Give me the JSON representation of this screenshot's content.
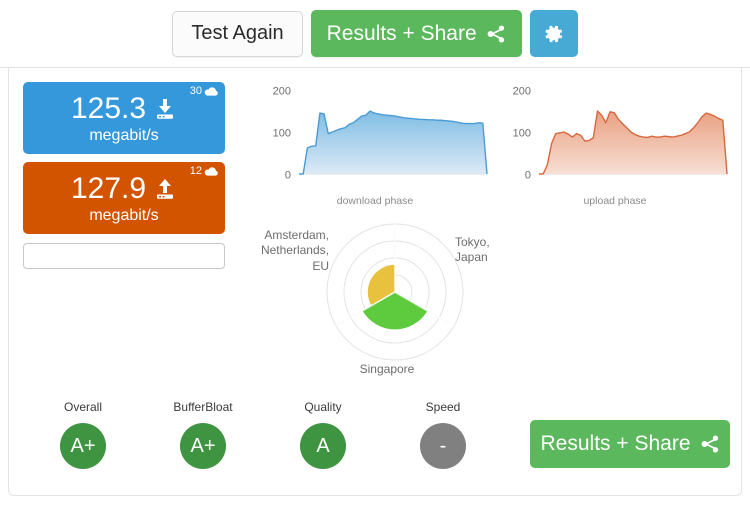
{
  "toolbar": {
    "test_again_label": "Test Again",
    "results_share_label": "Results + Share",
    "share_icon": "share-nodes-icon",
    "settings_icon": "gear-icon"
  },
  "speed": {
    "download": {
      "value": "125.3",
      "unit": "megabit/s",
      "badge_count": "30",
      "badge_icon": "cloud-icon",
      "direction_icon": "download-arrow-icon",
      "color": "#3498db"
    },
    "upload": {
      "value": "127.9",
      "unit": "megabit/s",
      "badge_count": "12",
      "badge_icon": "cloud-icon",
      "direction_icon": "upload-arrow-icon",
      "color": "#d35400"
    }
  },
  "share_input": {
    "value": "",
    "placeholder": ""
  },
  "chart_data": [
    {
      "type": "area",
      "title": "",
      "xlabel": "download phase",
      "ylabel": "",
      "ylim": [
        0,
        200
      ],
      "yticks": [
        "0",
        "100",
        "200"
      ],
      "ytick_values": [
        0,
        100,
        200
      ],
      "grid": false,
      "color": "#4a9bd4",
      "fill_top": "#7fbde4",
      "fill_bottom": "#dceaf6",
      "x": [
        0,
        1,
        2,
        3,
        4,
        5,
        6,
        7,
        8,
        9,
        10,
        11,
        12,
        13,
        14,
        15,
        16,
        17,
        18,
        19,
        20,
        21,
        22,
        23,
        24,
        25,
        26,
        27,
        28,
        29,
        30,
        31,
        32,
        33,
        34,
        35,
        36,
        37,
        38,
        39,
        40,
        41,
        42,
        43,
        44,
        45
      ],
      "values": [
        0,
        0,
        62,
        66,
        67,
        145,
        143,
        96,
        100,
        104,
        108,
        110,
        118,
        122,
        130,
        138,
        140,
        150,
        145,
        143,
        141,
        140,
        139,
        138,
        136,
        134,
        133,
        132,
        131,
        130,
        130,
        129,
        129,
        128,
        128,
        127,
        126,
        125,
        123,
        121,
        120,
        120,
        120,
        122,
        121,
        0
      ]
    },
    {
      "type": "area",
      "title": "",
      "xlabel": "upload phase",
      "ylabel": "",
      "ylim": [
        0,
        200
      ],
      "yticks": [
        "0",
        "100",
        "200"
      ],
      "ytick_values": [
        0,
        100,
        200
      ],
      "grid": false,
      "color": "#d9673c",
      "fill_top": "#e9a182",
      "fill_bottom": "#f7dfd4",
      "x": [
        0,
        1,
        2,
        3,
        4,
        5,
        6,
        7,
        8,
        9,
        10,
        11,
        12,
        13,
        14,
        15,
        16,
        17,
        18,
        19,
        20,
        21,
        22,
        23,
        24,
        25,
        26,
        27,
        28,
        29,
        30,
        31,
        32,
        33,
        34,
        35,
        36,
        37,
        38,
        39,
        40,
        41,
        42,
        43,
        44,
        45
      ],
      "values": [
        0,
        0,
        22,
        72,
        96,
        98,
        100,
        95,
        88,
        96,
        92,
        78,
        80,
        86,
        150,
        140,
        122,
        148,
        146,
        130,
        120,
        110,
        100,
        94,
        90,
        88,
        87,
        90,
        88,
        88,
        90,
        89,
        88,
        90,
        92,
        96,
        100,
        110,
        122,
        136,
        145,
        142,
        138,
        132,
        128,
        0
      ]
    },
    {
      "type": "pie",
      "chart_style": "radar-sector",
      "title": "",
      "rings": 4,
      "max_radius_value": 100,
      "categories": [
        "Tokyo,\nJapan",
        "Amsterdam,\nNetherlands,\nEU",
        "Singapore"
      ],
      "values": [
        0,
        40,
        55
      ],
      "colors": [
        "#e0e0e0",
        "#e8c23f",
        "#5ecb3e"
      ],
      "label_positions": [
        "right",
        "left",
        "bottom"
      ]
    }
  ],
  "grades": {
    "items": [
      {
        "label": "Overall",
        "grade": "A+",
        "color": "#3f9442"
      },
      {
        "label": "BufferBloat",
        "grade": "A+",
        "color": "#3f9442"
      },
      {
        "label": "Quality",
        "grade": "A",
        "color": "#3f9442"
      },
      {
        "label": "Speed",
        "grade": "-",
        "color": "#808080"
      }
    ]
  },
  "bottom": {
    "results_share_label": "Results + Share",
    "share_icon": "share-nodes-icon"
  }
}
